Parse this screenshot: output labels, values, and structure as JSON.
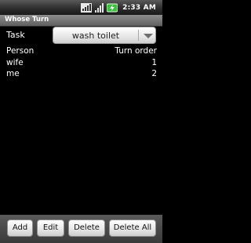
{
  "status_bar": {
    "time": "2:33 AM",
    "icons": [
      "network-3g-icon",
      "signal-strength-icon",
      "battery-charging-icon"
    ]
  },
  "app": {
    "title": "Whose Turn"
  },
  "task": {
    "label": "Task",
    "selected": "wash toilet"
  },
  "table": {
    "columns": [
      "Person",
      "Turn order"
    ],
    "rows": [
      {
        "person": "wife",
        "order": "1"
      },
      {
        "person": "me",
        "order": "2"
      }
    ]
  },
  "buttons": {
    "add": "Add",
    "edit": "Edit",
    "delete": "Delete",
    "delete_all": "Delete All"
  },
  "colors": {
    "background": "#000000",
    "battery_accent": "#3fbf3f"
  }
}
